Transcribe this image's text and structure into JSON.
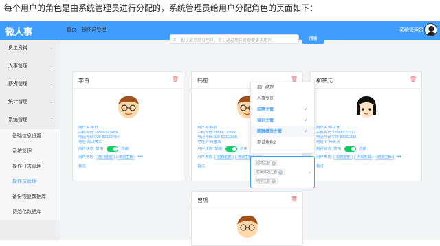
{
  "caption": "每个用户的角色是由系统管理员进行分配的，系统管理员给用户分配角色的页面如下：",
  "header": {
    "title": "微人事",
    "user": "系统管理员"
  },
  "sidebar": {
    "items": [
      {
        "label": "员工资料"
      },
      {
        "label": "人事管理"
      },
      {
        "label": "薪资管理"
      },
      {
        "label": "统计管理"
      },
      {
        "label": "系统管理"
      }
    ],
    "submenu": [
      "基础信息设置",
      "系统管理",
      "操作日志管理",
      "操作员管理",
      "备份恢复数据库",
      "初始化数据库"
    ]
  },
  "breadcrumb": {
    "home": "首页",
    "current": "操作员管理"
  },
  "search": {
    "placeholder": "默认展示部分用户，可以通过用户名搜索更多用户...",
    "button": "搜索"
  },
  "cards": [
    {
      "name": "李白",
      "username": "用户名:李白",
      "phone": "手机号码:18568123489",
      "tel": "电话号码:029-82123434",
      "address": "地址:海口美兰",
      "status_label": "用户状态:",
      "disabled": "禁用",
      "enabled": "启用",
      "roles_label": "用户角色:",
      "roles": [
        "部门经理",
        "培训主管"
      ],
      "more": "•••",
      "remark": "备注"
    },
    {
      "name": "韩愈",
      "username": "用户名:韩愈",
      "phone": "手机号码:18568123666",
      "tel": "电话号码:029-82111555",
      "address": "地址:广州番禺",
      "status_label": "用户状态:",
      "disabled": "禁用",
      "enabled": "启用",
      "roles_label": "用户角色:",
      "roles": [
        "招聘主管",
        "培训主管"
      ],
      "more": "•••",
      "remark": "备注"
    },
    {
      "name": "柳宗元",
      "username": "用户名:柳宗元",
      "phone": "手机号码:18568123377",
      "tel": "电话号码:029-82111333",
      "address": "地址:广州天河",
      "status_label": "用户状态:",
      "disabled": "禁用",
      "enabled": "启用",
      "roles_label": "用户角色:",
      "roles": [
        "招聘主管",
        "人事专员",
        "培训主管"
      ],
      "more": "•••",
      "remark": "备注"
    },
    {
      "name": "曾巩"
    }
  ],
  "dropdown": {
    "items": [
      {
        "label": "部门经理",
        "selected": false
      },
      {
        "label": "人事专员",
        "selected": false
      },
      {
        "label": "招聘主管",
        "selected": true
      },
      {
        "label": "培训主管",
        "selected": true
      },
      {
        "label": "薪酬绩效主管",
        "selected": true
      },
      {
        "label": "测试角色2",
        "selected": false
      }
    ],
    "check": "✓"
  },
  "multiselect": {
    "tags": [
      "招聘主管",
      "薪酬绩效主管",
      "培训主管"
    ]
  },
  "colors": {
    "primary": "#409eff",
    "danger": "#f56c6c",
    "success": "#13ce66"
  }
}
